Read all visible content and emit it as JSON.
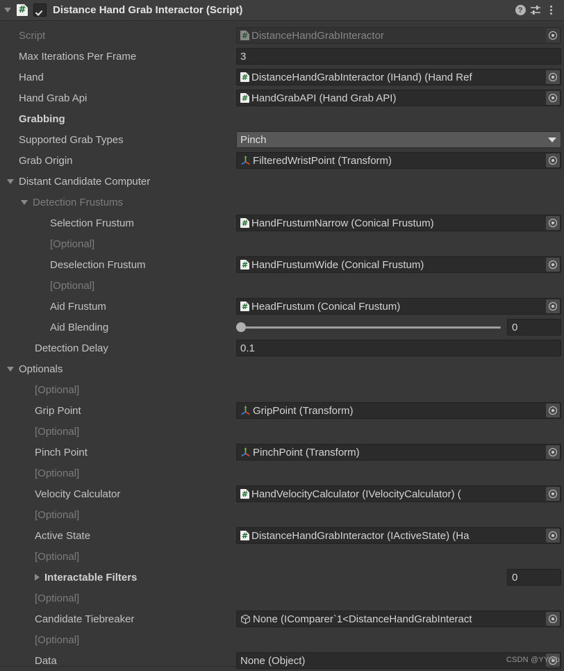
{
  "header": {
    "title": "Distance Hand Grab Interactor (Script)",
    "enabled_checkbox": "checked",
    "foldout": "expanded",
    "help_label": "?",
    "preset_label": "preset-icon",
    "menu_label": "more-menu"
  },
  "colors": {
    "window_bg": "#383838",
    "header_bg": "#3e3e3e",
    "field_bg": "#2b2b2b",
    "dropdown_bg": "#585858",
    "label_text": "#c3c3c3",
    "dim_text": "#7d7d7d",
    "script_green": "#1a6b2e"
  },
  "rows": [
    {
      "label": "Script",
      "dim": true,
      "type": "object",
      "icon": "script-icon",
      "value": "DistanceHandGrabInteractor",
      "disabled": true,
      "indent": "indent-0"
    },
    {
      "label": "Max Iterations Per Frame",
      "type": "text",
      "value": "3",
      "indent": "indent-0"
    },
    {
      "label": "Hand",
      "type": "object",
      "icon": "script-icon",
      "value": "DistanceHandGrabInteractor (IHand) (Hand Ref",
      "indent": "indent-0"
    },
    {
      "label": "Hand Grab Api",
      "type": "object",
      "icon": "script-icon",
      "value": "HandGrabAPI (Hand Grab API)",
      "indent": "indent-0"
    },
    {
      "label": "Grabbing",
      "type": "header",
      "bold": true,
      "indent": "indent-0"
    },
    {
      "label": "Supported Grab Types",
      "type": "dropdown",
      "value": "Pinch",
      "indent": "indent-0"
    },
    {
      "label": "Grab Origin",
      "type": "object",
      "icon": "transform-icon",
      "value": "FilteredWristPoint (Transform)",
      "indent": "indent-0"
    },
    {
      "label": "Distant Candidate Computer",
      "type": "foldout",
      "foldout": "expanded",
      "indent": "indent-f0"
    },
    {
      "label": "Detection Frustums",
      "type": "foldout",
      "foldout": "expanded",
      "dim": true,
      "indent": "indent-f1"
    },
    {
      "label": "Selection Frustum",
      "type": "object",
      "icon": "script-icon",
      "value": "HandFrustumNarrow (Conical Frustum)",
      "indent": "indent-2"
    },
    {
      "label": "[Optional]",
      "type": "optional",
      "dim": true,
      "indent": "indent-2"
    },
    {
      "label": "Deselection Frustum",
      "type": "object",
      "icon": "script-icon",
      "value": "HandFrustumWide (Conical Frustum)",
      "indent": "indent-2"
    },
    {
      "label": "[Optional]",
      "type": "optional",
      "dim": true,
      "indent": "indent-2"
    },
    {
      "label": "Aid Frustum",
      "type": "object",
      "icon": "script-icon",
      "value": "HeadFrustum (Conical Frustum)",
      "indent": "indent-2"
    },
    {
      "label": "Aid Blending",
      "type": "slider",
      "value": "0",
      "slider_percent": 0,
      "indent": "indent-2"
    },
    {
      "label": "Detection Delay",
      "type": "text",
      "value": "0.1",
      "indent": "indent-1"
    },
    {
      "label": "Optionals",
      "type": "foldout",
      "foldout": "expanded",
      "indent": "indent-f0"
    },
    {
      "label": "[Optional]",
      "type": "optional",
      "dim": true,
      "indent": "indent-1"
    },
    {
      "label": "Grip Point",
      "type": "object",
      "icon": "transform-icon",
      "value": "GripPoint (Transform)",
      "indent": "indent-1"
    },
    {
      "label": "[Optional]",
      "type": "optional",
      "dim": true,
      "indent": "indent-1"
    },
    {
      "label": "Pinch Point",
      "type": "object",
      "icon": "transform-icon",
      "value": "PinchPoint (Transform)",
      "indent": "indent-1"
    },
    {
      "label": "[Optional]",
      "type": "optional",
      "dim": true,
      "indent": "indent-1"
    },
    {
      "label": "Velocity Calculator",
      "type": "object",
      "icon": "script-icon",
      "value": "HandVelocityCalculator (IVelocityCalculator) (",
      "indent": "indent-1"
    },
    {
      "label": "[Optional]",
      "type": "optional",
      "dim": true,
      "indent": "indent-1"
    },
    {
      "label": "Active State",
      "type": "object",
      "icon": "script-icon",
      "value": "DistanceHandGrabInteractor (IActiveState) (Ha",
      "indent": "indent-1"
    },
    {
      "label": "[Optional]",
      "type": "optional",
      "dim": true,
      "indent": "indent-1"
    },
    {
      "label": "Interactable Filters",
      "type": "arrayfold",
      "bold": true,
      "foldout": "collapsed",
      "value": "0",
      "indent": "indent-filters"
    },
    {
      "label": "[Optional]",
      "type": "optional",
      "dim": true,
      "indent": "indent-1"
    },
    {
      "label": "Candidate Tiebreaker",
      "type": "object",
      "icon": "cube-icon",
      "value": "None (IComparer`1<DistanceHandGrabInteract",
      "indent": "indent-1"
    },
    {
      "label": "[Optional]",
      "type": "optional",
      "dim": true,
      "indent": "indent-1"
    },
    {
      "label": "Data",
      "type": "object",
      "icon": "none",
      "value": "None (Object)",
      "indent": "indent-1"
    }
  ],
  "watermark": "CSDN @YY-nb"
}
